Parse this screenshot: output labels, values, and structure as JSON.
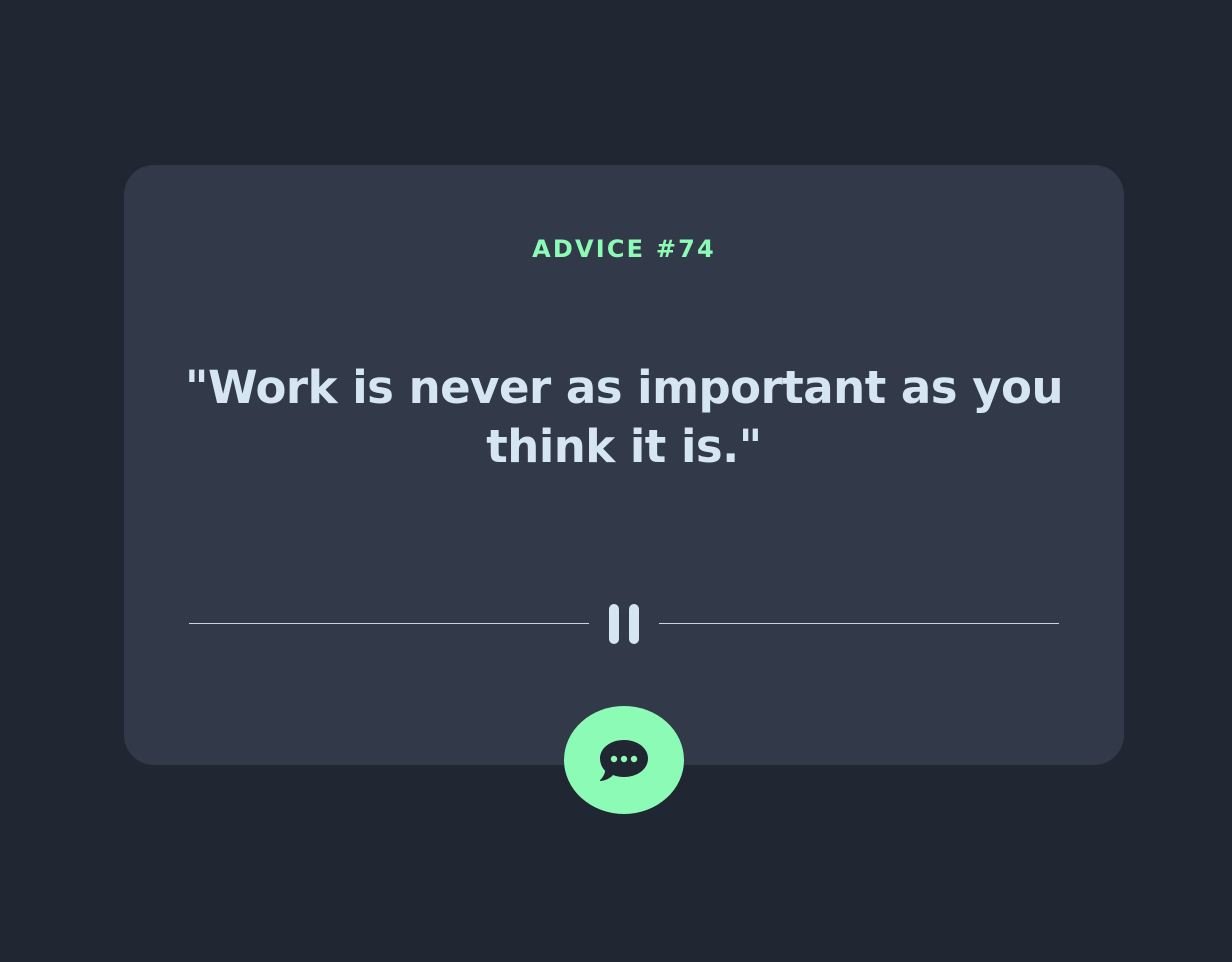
{
  "advice": {
    "label": "ADVICE #74",
    "quote": "\"Work is never as important as you think it is.\""
  },
  "divider": {
    "icon": "pause-icon"
  },
  "button": {
    "icon": "chat-bubble-icon"
  },
  "colors": {
    "background": "#202632",
    "card": "#323a49",
    "accent": "#8cfbb5",
    "text": "#d5e6f1"
  }
}
